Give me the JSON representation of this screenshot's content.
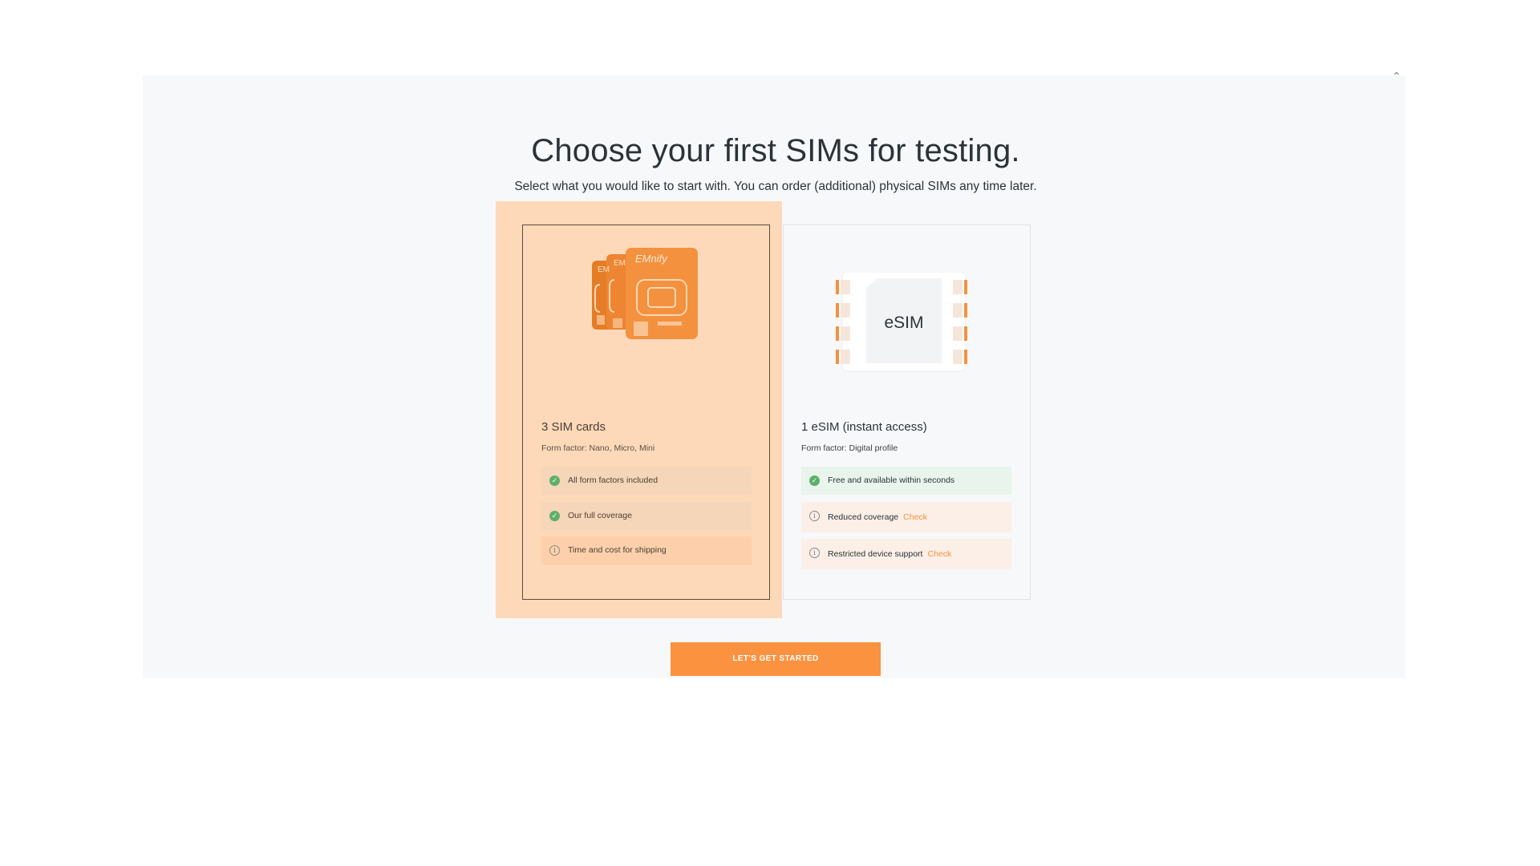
{
  "header": {
    "title": "Choose your first SIMs for testing.",
    "subtitle": "Select what you would like to start with. You can order (additional) physical SIMs any time later."
  },
  "options": [
    {
      "id": "physical",
      "title": "3 SIM cards",
      "form_factor": "Form factor: Nano, Micro, Mini",
      "brand": "EMnify",
      "features": [
        {
          "text": "All form factors included",
          "type": "check"
        },
        {
          "text": "Our full coverage",
          "type": "check"
        },
        {
          "text": "Time and cost for shipping",
          "type": "info"
        }
      ],
      "selected": true
    },
    {
      "id": "esim",
      "title": "1 eSIM (instant access)",
      "form_factor": "Form factor: Digital profile",
      "chip_label": "eSIM",
      "features": [
        {
          "text": "Free and available within seconds",
          "type": "check"
        },
        {
          "text": "Reduced coverage",
          "type": "info",
          "link": "Check"
        },
        {
          "text": "Restricted device support",
          "type": "info",
          "link": "Check"
        }
      ],
      "selected": false
    }
  ],
  "cta": {
    "label": "LET'S GET STARTED"
  },
  "colors": {
    "accent": "#fa923f",
    "selected_bg": "#fdd9b9",
    "success": "#5fae6b",
    "panel_bg": "#f7f8fa"
  },
  "icons": {
    "collapse": "chevron-up-icon",
    "check": "check-circle-icon",
    "info": "info-circle-icon"
  }
}
